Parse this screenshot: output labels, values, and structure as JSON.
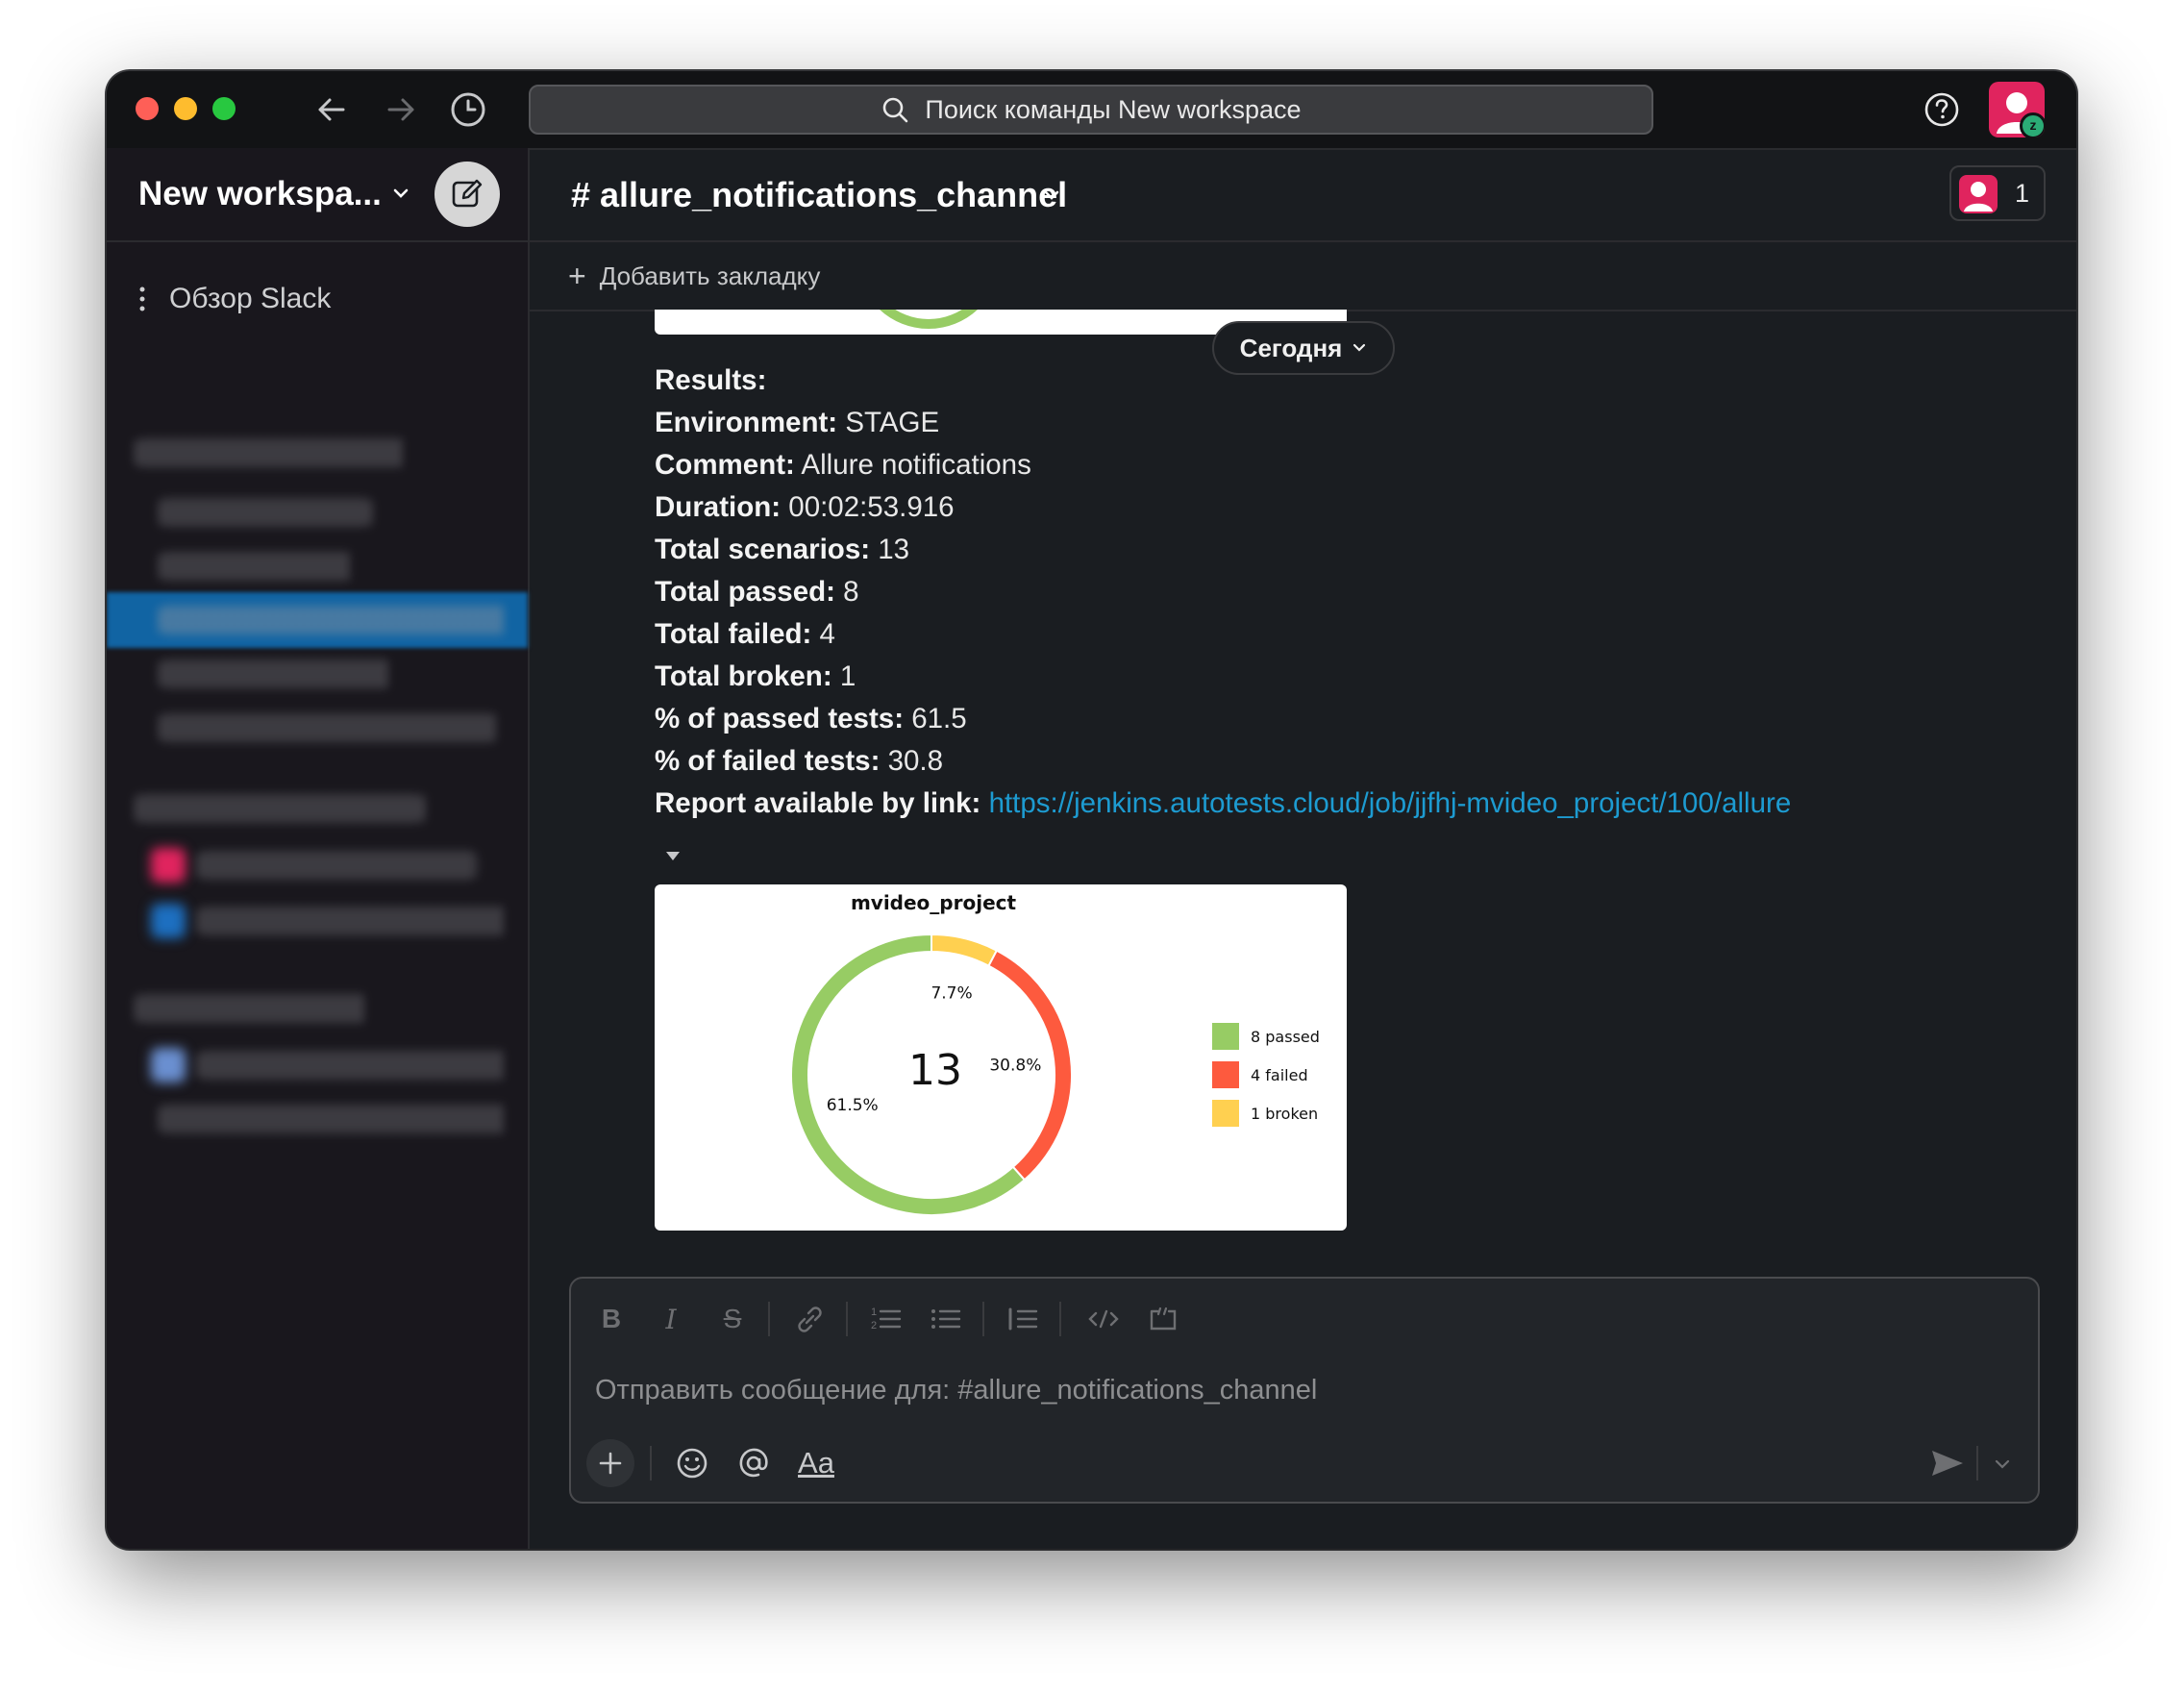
{
  "search": {
    "placeholder": "Поиск команды New workspace"
  },
  "workspace": {
    "name": "New workspa..."
  },
  "sidebar": {
    "overview": "Обзор Slack"
  },
  "channel": {
    "name": "# allure_notifications_channel",
    "member_count": "1"
  },
  "bookmark": {
    "label": "Добавить закладку"
  },
  "date_divider": "Сегодня",
  "message": {
    "rows": [
      {
        "label": "Results:",
        "value": ""
      },
      {
        "label": "Environment:",
        "value": " STAGE"
      },
      {
        "label": "Comment:",
        "value": " Allure notifications"
      },
      {
        "label": "Duration:",
        "value": " 00:02:53.916"
      },
      {
        "label": "Total scenarios:",
        "value": " 13"
      },
      {
        "label": "Total passed:",
        "value": " 8"
      },
      {
        "label": "Total failed:",
        "value": " 4"
      },
      {
        "label": "Total broken:",
        "value": " 1"
      },
      {
        "label": "% of passed tests:",
        "value": " 61.5"
      },
      {
        "label": "% of failed tests:",
        "value": " 30.8"
      }
    ],
    "report_label": "Report available by link:",
    "report_link": "https://jenkins.autotests.cloud/job/jjfhj-mvideo_project/100/allure"
  },
  "chart_data": {
    "type": "pie",
    "variant": "donut",
    "title": "mvideo_project",
    "center_label": "13",
    "slices": [
      {
        "legend": "8 passed",
        "value": 8,
        "pct_label": "61.5%",
        "color": "#97cc64"
      },
      {
        "legend": "4 failed",
        "value": 4,
        "pct_label": "30.8%",
        "color": "#fd5a3e"
      },
      {
        "legend": "1 broken",
        "value": 1,
        "pct_label": "7.7%",
        "color": "#ffd050"
      }
    ],
    "legend_position": "right"
  },
  "composer": {
    "placeholder": "Отправить сообщение для: #allure_notifications_channel",
    "format_label": "Aa"
  },
  "colors": {
    "accent": "#1164a3",
    "link": "#1d9bd1",
    "avatar": "#e0245e",
    "presence": "#2bac76"
  }
}
